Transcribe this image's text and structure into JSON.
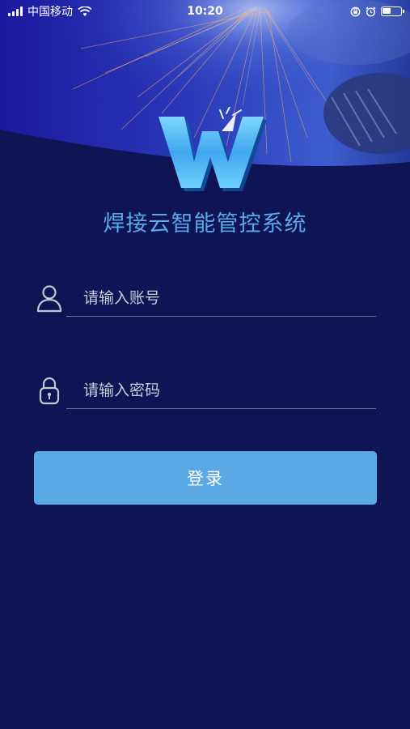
{
  "status_bar": {
    "carrier": "中国移动",
    "time": "10:20",
    "icons": [
      "signal-icon",
      "wifi-icon",
      "orientation-lock-icon",
      "alarm-icon",
      "battery-icon"
    ]
  },
  "app": {
    "title": "焊接云智能管控系统"
  },
  "login_form": {
    "username": {
      "placeholder": "请输入账号",
      "value": "",
      "icon": "user-icon"
    },
    "password": {
      "placeholder": "请输入密码",
      "value": "",
      "icon": "lock-icon"
    },
    "submit_label": "登录"
  },
  "colors": {
    "background": "#0f1454",
    "accent": "#5aa8e6",
    "title": "#5aa8e6",
    "divider": "#6e7296"
  }
}
